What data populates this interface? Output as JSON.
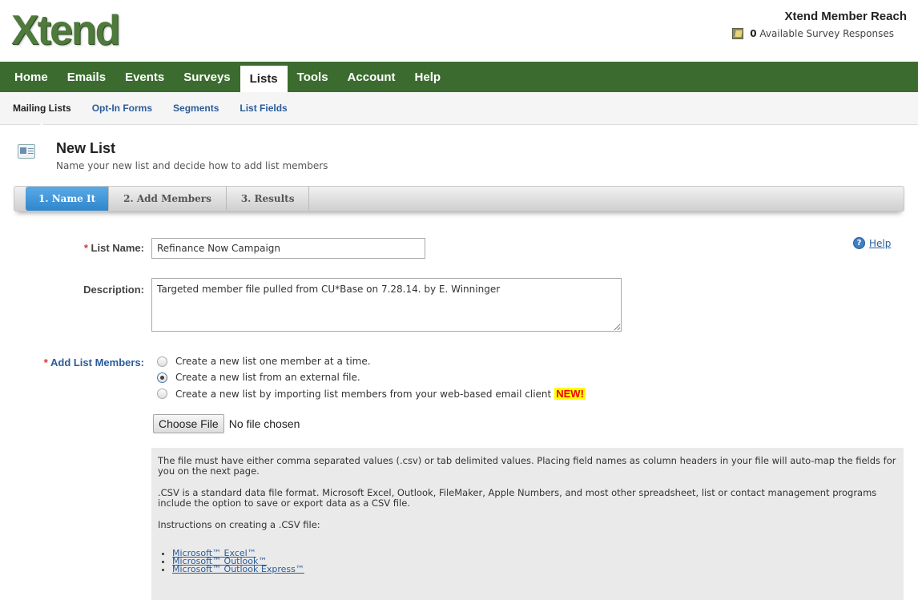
{
  "header": {
    "logo": "Xtend",
    "brand_title": "Xtend Member Reach",
    "survey_count": "0",
    "survey_label": "Available Survey Responses"
  },
  "main_nav": [
    "Home",
    "Emails",
    "Events",
    "Surveys",
    "Lists",
    "Tools",
    "Account",
    "Help"
  ],
  "main_nav_active": "Lists",
  "sub_nav": [
    "Mailing Lists",
    "Opt-In Forms",
    "Segments",
    "List Fields"
  ],
  "page": {
    "title": "New List",
    "subtitle": "Name your new list and decide how to add list members"
  },
  "wizard": [
    "1. Name It",
    "2. Add Members",
    "3. Results"
  ],
  "form": {
    "list_name_label": "List Name:",
    "list_name_value": "Refinance Now Campaign",
    "description_label": "Description:",
    "description_value": "Targeted member file pulled from CU*Base on 7.28.14. by E. Winninger",
    "add_members_label": "Add List Members:",
    "options": [
      "Create a new list one member at a time.",
      "Create a new list from an external file.",
      "Create a new list by importing list members from your web-based email client"
    ],
    "selected_option": 1,
    "new_badge": "NEW!",
    "help_label": "Help",
    "required_mark": "*",
    "file_button": "Choose File",
    "file_status": "No file chosen"
  },
  "info": {
    "para1": "The file must have either comma separated values (.csv) or tab delimited values. Placing field names as column headers in your file will auto-map the fields for you on the next page.",
    "para2": ".CSV is a standard data file format. Microsoft Excel, Outlook, FileMaker, Apple Numbers, and most other spreadsheet, list or contact management programs include the option to save or export data as a CSV file.",
    "para3": "Instructions on creating a .CSV file:",
    "links": [
      "Microsoft™ Excel™",
      "Microsoft™ Outlook™",
      "Microsoft™ Outlook Express™"
    ]
  },
  "colors": {
    "nav_green": "#3b6b2f",
    "logo_green": "#4e7a3c",
    "wizard_active": "#3d91d6",
    "link_blue": "#2a5c9a"
  }
}
